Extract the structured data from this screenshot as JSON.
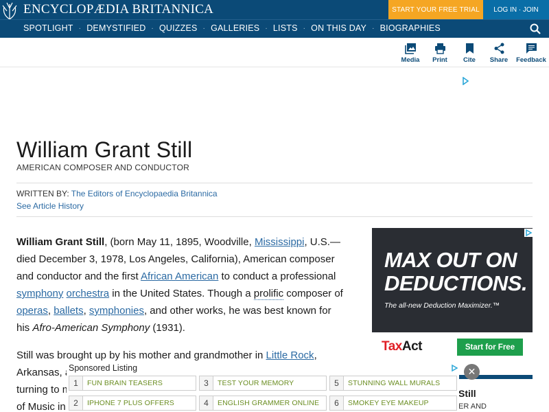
{
  "header": {
    "logo_text": "ENCYCLOPÆDIA BRITANNICA",
    "cta": "START YOUR FREE TRIAL",
    "login": "LOG IN · JOIN"
  },
  "nav": {
    "items": [
      "SPOTLIGHT",
      "DEMYSTIFIED",
      "QUIZZES",
      "GALLERIES",
      "LISTS",
      "ON THIS DAY",
      "BIOGRAPHIES"
    ],
    "separator": "·"
  },
  "tools": {
    "media": "Media",
    "print": "Print",
    "cite": "Cite",
    "share": "Share",
    "feedback": "Feedback"
  },
  "article": {
    "title": "William Grant Still",
    "subtitle": "AMERICAN COMPOSER AND CONDUCTOR",
    "written_by_label": "WRITTEN BY:",
    "author": "The Editors of Encyclopaedia Britannica",
    "history_link": "See Article History",
    "p1": {
      "bold": "William Grant Still",
      "t1": ", (born May 11, 1895, Woodville, ",
      "l1": "Mississippi",
      "t2": ", U.S.—died December 3, 1978, Los Angeles, California), American composer and conductor and the first ",
      "l2": "African American",
      "t3": " to conduct a professional ",
      "l3": "symphony",
      "t4": " ",
      "l4": "orchestra",
      "t5": " in the United States. Though a ",
      "l5": "prolific",
      "t6": " composer of ",
      "l6": "operas",
      "t7": ", ",
      "l7": "ballets",
      "t8": ", ",
      "l8": "symphonies",
      "t9": ", and other works, he was best known for his ",
      "italic": "Afro-American Symphony",
      "t10": " (1931)."
    },
    "p2": {
      "t1": "Still was brought up by his mother and grandmother in ",
      "l1": "Little Rock",
      "t2": ",",
      "t3": "Arkansas, a",
      "t4": "turning to m",
      "t5": "of Music in"
    }
  },
  "ad_right": {
    "headline1": "MAX OUT ON",
    "headline2": "DEDUCTIONS.",
    "sub": "The all-new Deduction Maximizer.™",
    "brand_tax": "Tax",
    "brand_act": "Act",
    "button": "Start for Free"
  },
  "card": {
    "name": "Still",
    "role": "ER AND"
  },
  "sponsored": {
    "label": "Sponsored Listing",
    "items": [
      {
        "num": "1",
        "text": "FUN BRAIN TEASERS"
      },
      {
        "num": "3",
        "text": "TEST YOUR MEMORY"
      },
      {
        "num": "5",
        "text": "STUNNING WALL MURALS"
      },
      {
        "num": "2",
        "text": "IPHONE 7 PLUS OFFERS"
      },
      {
        "num": "4",
        "text": "ENGLISH GRAMMER ONLINE"
      },
      {
        "num": "6",
        "text": "SMOKEY EYE MAKEUP"
      }
    ],
    "close": "✕"
  },
  "colors": {
    "header_blue": "#0b4a77",
    "cta_orange": "#f5a623",
    "login_blue": "#0a6ea7",
    "link_blue": "#2b6aa3",
    "ad_green": "#1e9f4c",
    "sponsored_text": "#6b8e23"
  }
}
